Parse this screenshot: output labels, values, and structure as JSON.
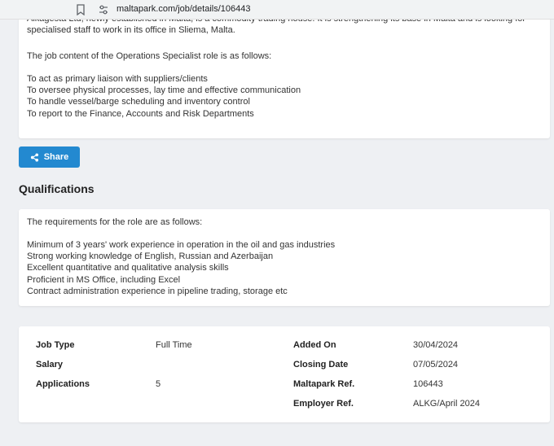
{
  "browser": {
    "url": "maltapark.com/job/details/106443"
  },
  "description": {
    "clipped_lines": [
      "Alkagesta Ltd, newly established in Malta, is a commodity trading house. It is strengthening its base in Malta and is looking for",
      "specialised staff to work in its office in Sliema, Malta."
    ],
    "intro": "The job content of the Operations Specialist role is as follows:",
    "items": [
      "To act as primary liaison with suppliers/clients",
      "To oversee physical processes, lay time and effective communication",
      "To handle vessel/barge scheduling and inventory control",
      "To report to the Finance, Accounts and Risk Departments"
    ]
  },
  "share": {
    "label": "Share"
  },
  "qualifications": {
    "title": "Qualifications",
    "intro": "The requirements for the role are as follows:",
    "items": [
      "Minimum of 3 years' work experience in operation in the oil and gas industries",
      "Strong working knowledge of English, Russian and Azerbaijan",
      "Excellent quantitative and qualitative analysis skills",
      "Proficient in MS Office, including Excel",
      "Contract administration experience in pipeline trading, storage etc"
    ]
  },
  "details": {
    "job_type_label": "Job Type",
    "job_type_value": "Full Time",
    "salary_label": "Salary",
    "salary_value": "",
    "applications_label": "Applications",
    "applications_value": "5",
    "added_on_label": "Added On",
    "added_on_value": "30/04/2024",
    "closing_date_label": "Closing Date",
    "closing_date_value": "07/05/2024",
    "maltapark_ref_label": "Maltapark Ref.",
    "maltapark_ref_value": "106443",
    "employer_ref_label": "Employer Ref.",
    "employer_ref_value": "ALKG/April 2024"
  }
}
